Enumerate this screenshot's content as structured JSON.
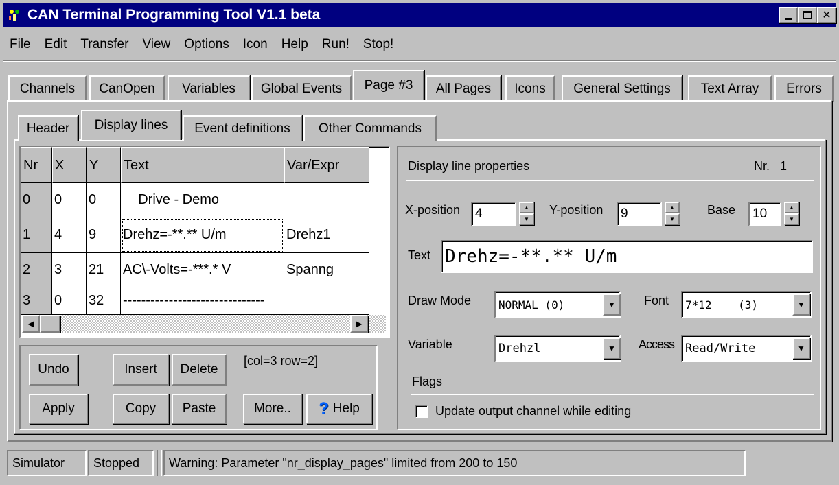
{
  "window": {
    "title": "CAN Terminal Programming Tool V1.1 beta"
  },
  "menu": [
    {
      "label": "File",
      "u": "F",
      "rest": "ile"
    },
    {
      "label": "Edit",
      "u": "E",
      "rest": "dit"
    },
    {
      "label": "Transfer",
      "u": "T",
      "rest": "ransfer"
    },
    {
      "label": "View",
      "u": "",
      "rest": "View"
    },
    {
      "label": "Options",
      "u": "O",
      "rest": "ptions"
    },
    {
      "label": "Icon",
      "u": "I",
      "rest": "con"
    },
    {
      "label": "Help",
      "u": "H",
      "rest": "elp"
    },
    {
      "label": "Run!",
      "u": "",
      "rest": "Run!"
    },
    {
      "label": "Stop!",
      "u": "",
      "rest": "Stop!"
    }
  ],
  "tabs": [
    "Channels",
    "CanOpen",
    "Variables",
    "Global Events",
    "Page #3",
    "All Pages",
    "Icons",
    "General Settings",
    "Text Array",
    "Errors"
  ],
  "active_tab": "Page #3",
  "subtabs": [
    "Header",
    "Display lines",
    "Event definitions",
    "Other Commands"
  ],
  "active_subtab": "Display lines",
  "grid": {
    "headers": [
      "Nr",
      "X",
      "Y",
      "Text",
      "Var/Expr"
    ],
    "rows": [
      [
        "0",
        "0",
        "0",
        "    Drive - Demo",
        ""
      ],
      [
        "1",
        "4",
        "9",
        "Drehz=-**.** U/m",
        "Drehz1"
      ],
      [
        "2",
        "3",
        "21",
        "AC\\-Volts=-***.* V",
        "Spanng"
      ],
      [
        "3",
        "0",
        "32",
        "-------------------------------",
        ""
      ]
    ]
  },
  "buttons": {
    "undo": "Undo",
    "insert": "Insert",
    "delete": "Delete",
    "apply": "Apply",
    "copy": "Copy",
    "paste": "Paste",
    "more": "More..",
    "help": "Help"
  },
  "cell_position": "[col=3 row=2]",
  "props": {
    "title": "Display line properties",
    "nr_label": "Nr.",
    "nr_value": "1",
    "x_label": "X-position",
    "x_value": "4",
    "y_label": "Y-position",
    "y_value": "9",
    "base_label": "Base",
    "base_value": "10",
    "text_label": "Text",
    "text_value": "Drehz=-**.** U/m",
    "drawmode_label": "Draw Mode",
    "drawmode_value": "NORMAL (0)",
    "font_label": "Font",
    "font_value": "7*12    (3)",
    "variable_label": "Variable",
    "variable_value": "Drehzl",
    "access_label": "Access",
    "access_value": "Read/Write",
    "flags_label": "Flags",
    "update_checkbox_label": "Update output channel while editing",
    "update_checked": false
  },
  "statusbar": {
    "mode": "Simulator",
    "state": "Stopped",
    "message": "Warning: Parameter \"nr_display_pages\" limited from 200 to 150"
  }
}
